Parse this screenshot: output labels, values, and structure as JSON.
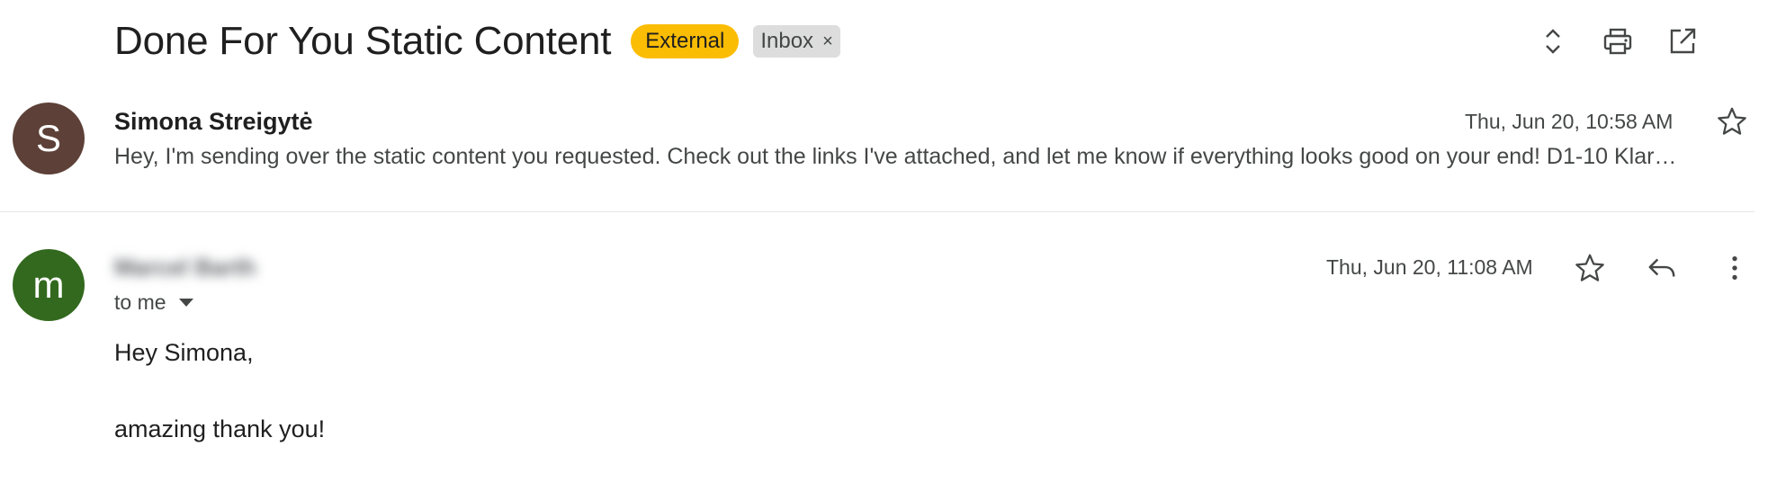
{
  "thread": {
    "subject": "Done For You Static Content",
    "labels": {
      "external": "External",
      "inbox": "Inbox",
      "inbox_remove_glyph": "×"
    },
    "icons": [
      "expand-collapse-icon",
      "print-icon",
      "open-in-new-window-icon"
    ]
  },
  "messages": [
    {
      "avatar_letter": "S",
      "avatar_color": "#5d4037",
      "sender": "Simona Streigytė",
      "timestamp": "Thu, Jun 20, 10:58 AM",
      "snippet": "Hey, I'm sending over the static content you requested. Check out the links I've attached, and let me know if everything looks good on your end! D1-10 Klar…"
    },
    {
      "avatar_letter": "m",
      "avatar_color": "#33691e",
      "sender_blurred": "Marcel Barth",
      "recipient": "to me",
      "timestamp": "Thu, Jun 20, 11:08 AM",
      "body": [
        "Hey Simona,",
        "amazing thank you!"
      ]
    }
  ],
  "colors": {
    "external_label": "#fbbc04",
    "inbox_label": "#dddddd"
  }
}
